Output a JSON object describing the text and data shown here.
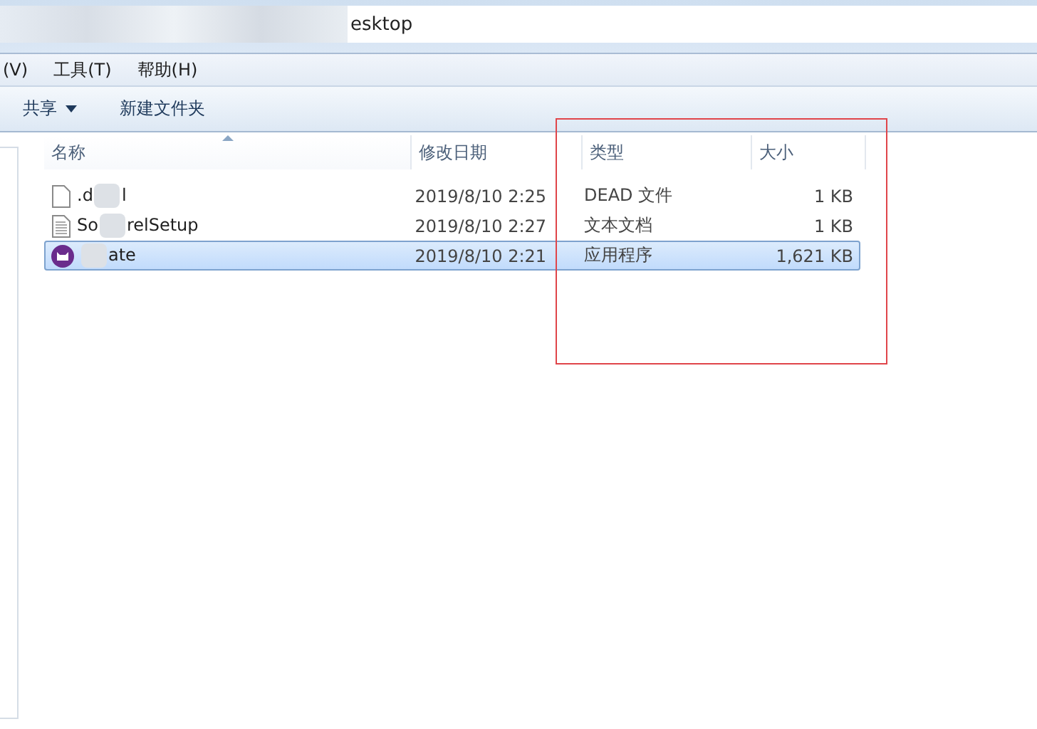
{
  "window": {
    "title": "esktop"
  },
  "menu": [
    "(V)",
    "工具(T)",
    "帮助(H)"
  ],
  "toolbar": [
    {
      "label": "共享",
      "dropdown": true
    },
    {
      "label": "新建文件夹",
      "dropdown": false
    }
  ],
  "table": {
    "columns": [
      {
        "label": "名称",
        "sorted": true
      },
      {
        "label": "修改日期",
        "sorted": false
      },
      {
        "label": "类型",
        "sorted": false
      },
      {
        "label": "大小",
        "sorted": false
      }
    ],
    "rows": [
      {
        "kind": "blank",
        "name_parts": [
          ".d",
          "l"
        ],
        "modified": "2019/8/10 2:25",
        "type": "DEAD 文件",
        "size": "1 KB",
        "selected": false
      },
      {
        "kind": "text",
        "name_parts": [
          "So",
          "relSetup"
        ],
        "modified": "2019/8/10 2:27",
        "type": "文本文档",
        "size": "1 KB",
        "selected": false
      },
      {
        "kind": "app",
        "name_parts": [
          "ate"
        ],
        "modified": "2019/8/10 2:21",
        "type": "应用程序",
        "size": "1,621 KB",
        "selected": true
      }
    ]
  }
}
